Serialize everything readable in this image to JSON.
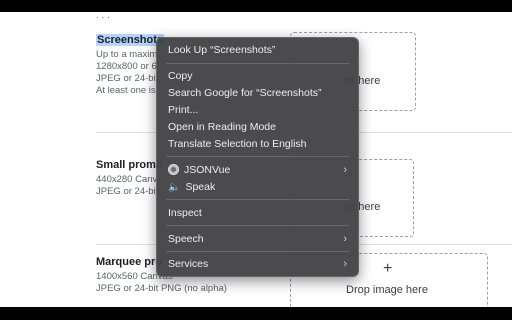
{
  "page": {
    "top_cut_text": "· · ·",
    "screenshots": {
      "title": "Screenshots",
      "lines": [
        "Up to a maxim",
        "1280x800 or 6",
        "JPEG or 24-bit",
        "At least one is"
      ]
    },
    "small_promo": {
      "title": "Small promo",
      "lines": [
        "440x280 Canv",
        "JPEG or 24-bit"
      ]
    },
    "marquee_promo": {
      "title": "Marquee pro",
      "lines": [
        "1400x560 Canvas",
        "JPEG or 24-bit PNG (no alpha)"
      ]
    },
    "dropzones": [
      {
        "text": "ge here"
      },
      {
        "text": "ge here"
      },
      {
        "plus": "+",
        "text": "Drop image here"
      }
    ]
  },
  "context_menu": {
    "items": [
      {
        "label": "Look Up “Screenshots”"
      },
      {
        "label": "Copy"
      },
      {
        "label": "Search Google for “Screenshots”"
      },
      {
        "label": "Print..."
      },
      {
        "label": "Open in Reading Mode"
      },
      {
        "label": "Translate Selection to English"
      },
      {
        "label": "JSONVue",
        "icon": "jsonvue-icon",
        "submenu": true
      },
      {
        "label": "Speak",
        "icon": "speaker-icon"
      },
      {
        "label": "Inspect"
      },
      {
        "label": "Speech",
        "submenu": true
      },
      {
        "label": "Services",
        "submenu": true
      }
    ],
    "chevron": "›",
    "speaker_glyph": "🔈"
  }
}
